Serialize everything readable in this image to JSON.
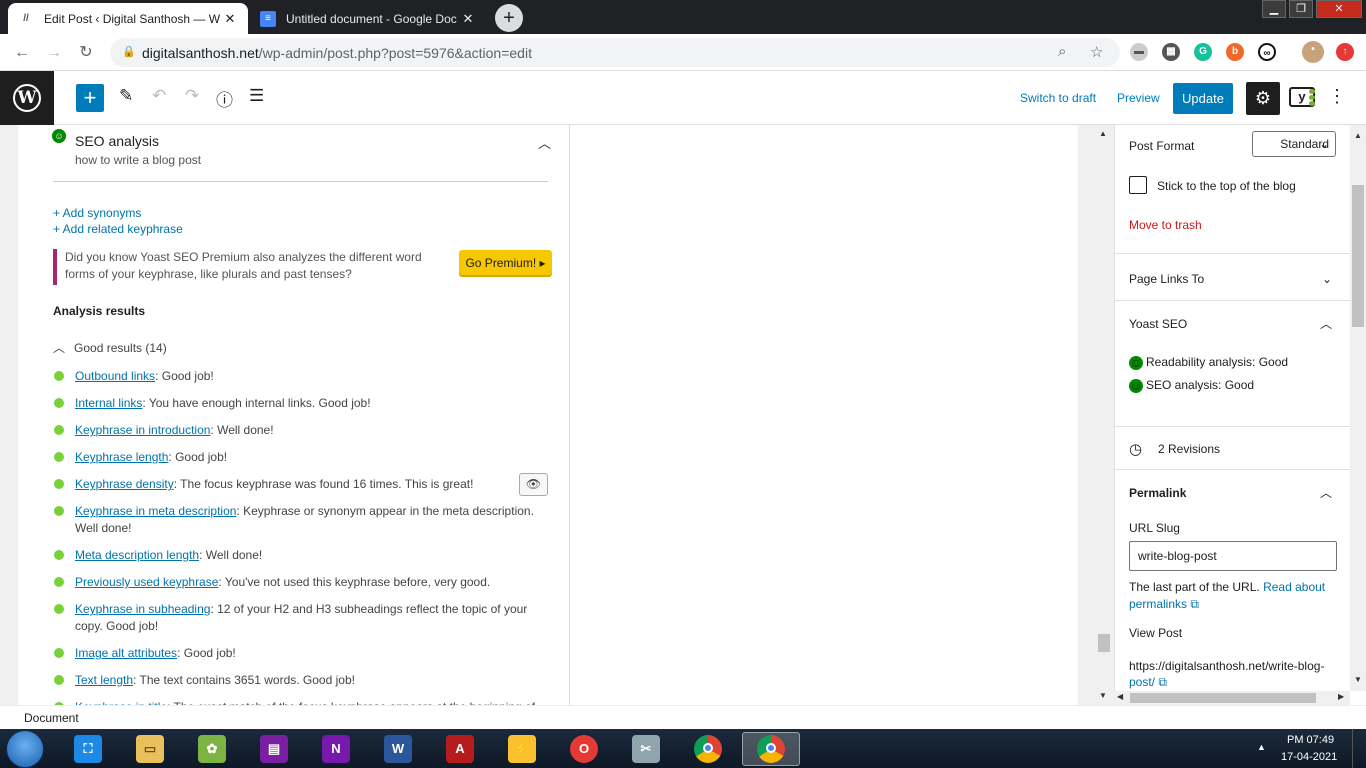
{
  "browser": {
    "tabs": [
      {
        "title": "Edit Post ‹ Digital Santhosh — W",
        "icon": "wordpress-favicon"
      },
      {
        "title": "Untitled document - Google Doc",
        "icon": "google-docs-favicon"
      }
    ],
    "url_host": "digitalsanthosh.net",
    "url_path": "/wp-admin/post.php?post=5976&action=edit"
  },
  "wp_toolbar": {
    "switch_to_draft": "Switch to draft",
    "preview": "Preview",
    "update": "Update",
    "yoast_label": "y"
  },
  "seo": {
    "title": "SEO analysis",
    "keyphrase": "how to write a blog post",
    "add_synonyms": "+ Add synonyms",
    "add_related": "+ Add related keyphrase",
    "premium_text": "Did you know Yoast SEO Premium also analyzes the different word forms of your keyphrase, like plurals and past tenses?",
    "go_premium": "Go Premium!",
    "analysis_results": "Analysis results",
    "good_results": "Good results (14)",
    "results": [
      {
        "link": "Outbound links",
        "text": ": Good job!"
      },
      {
        "link": "Internal links",
        "text": ": You have enough internal links. Good job!"
      },
      {
        "link": "Keyphrase in introduction",
        "text": ": Well done!"
      },
      {
        "link": "Keyphrase length",
        "text": ": Good job!"
      },
      {
        "link": "Keyphrase density",
        "text": ": The focus keyphrase was found 16 times. This is great!"
      },
      {
        "link": "Keyphrase in meta description",
        "text": ": Keyphrase or synonym appear in the meta description. Well done!"
      },
      {
        "link": "Meta description length",
        "text": ": Well done!"
      },
      {
        "link": "Previously used keyphrase",
        "text": ": You've not used this keyphrase before, very good."
      },
      {
        "link": "Keyphrase in subheading",
        "text": ": 12 of your H2 and H3 subheadings reflect the topic of your copy. Good job!"
      },
      {
        "link": "Image alt attributes",
        "text": ": Good job!"
      },
      {
        "link": "Text length",
        "text": ": The text contains 3651 words. Good job!"
      },
      {
        "link": "Keyphrase in title",
        "text": ": The exact match of the focus keyphrase appears at the beginning of"
      }
    ]
  },
  "sidebar": {
    "post_format_label": "Post Format",
    "post_format_value": "Standard",
    "stick_label": "Stick to the top of the blog",
    "move_to_trash": "Move to trash",
    "page_links_to": "Page Links To",
    "yoast_seo": "Yoast SEO",
    "readability": "Readability analysis: Good",
    "seo_analysis": "SEO analysis: Good",
    "revisions": "2 Revisions",
    "permalink": "Permalink",
    "url_slug_label": "URL Slug",
    "url_slug_value": "write-blog-post",
    "last_part": "The last part of the URL.",
    "read_about": "Read about",
    "permalinks": "permalinks",
    "view_post": "View Post",
    "view_post_url_1": "https://digitalsanthosh.net/write-blog-",
    "view_post_url_2": "post/"
  },
  "statusbar": {
    "text": "Document"
  },
  "taskbar": {
    "time": "PM 07:49",
    "date": "17-04-2021",
    "apps": [
      "screen-capture",
      "file-explorer",
      "gimp",
      "winrar",
      "onenote",
      "word",
      "acrobat",
      "pdf-tool",
      "opera",
      "snipping-tool",
      "chrome",
      "chrome-active"
    ]
  },
  "colors": {
    "wp_blue": "#007cba",
    "yoast_purple": "#a4286a",
    "yoast_green": "#7ad03a",
    "premium_yellow": "#f7c700",
    "trash_red": "#cc1818"
  }
}
